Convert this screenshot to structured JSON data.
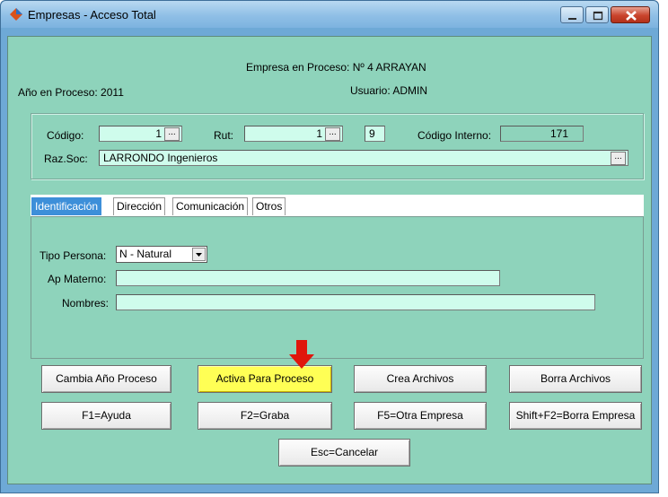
{
  "window": {
    "title": "Empresas - Acceso Total",
    "icon": "app-diamond-icon",
    "controls": [
      "minimize-icon",
      "maximize-icon",
      "close-icon"
    ]
  },
  "header": {
    "empresa_label": "Empresa en Proceso: Nº 4 ARRAYAN",
    "anio_label": "Año en Proceso: 2011",
    "usuario_label": "Usuario: ADMIN"
  },
  "form": {
    "codigo": {
      "label": "Código:",
      "value": "1"
    },
    "rut": {
      "label": "Rut:",
      "value": "1",
      "dv": "9"
    },
    "codigo_interno": {
      "label": "Código Interno:",
      "value": "171"
    },
    "razsoc": {
      "label": "Raz.Soc:",
      "value": "LARRONDO Ingenieros"
    },
    "ellipsis": "..."
  },
  "tabs": [
    {
      "label": "Identificación",
      "active": true
    },
    {
      "label": "Dirección",
      "active": false
    },
    {
      "label": "Comunicación",
      "active": false
    },
    {
      "label": "Otros",
      "active": false
    }
  ],
  "identificacion": {
    "tipo_persona": {
      "label": "Tipo Persona:",
      "value": "N - Natural"
    },
    "ap_materno": {
      "label": "Ap Materno:",
      "value": ""
    },
    "nombres": {
      "label": "Nombres:",
      "value": ""
    }
  },
  "buttons": {
    "cambia_anio": "Cambia Año Proceso",
    "activa": "Activa Para Proceso",
    "crea_archivos": "Crea Archivos",
    "borra_archivos": "Borra Archivos",
    "f1": "F1=Ayuda",
    "f2": "F2=Graba",
    "f5": "F5=Otra Empresa",
    "shift_f2": "Shift+F2=Borra Empresa",
    "esc": "Esc=Cancelar"
  },
  "colors": {
    "client_bg": "#8ed3bb",
    "field_bg": "#cffcec",
    "highlight_button": "#ffff55",
    "annotation_arrow": "#e0160c",
    "active_tab": "#3d8fd9"
  }
}
